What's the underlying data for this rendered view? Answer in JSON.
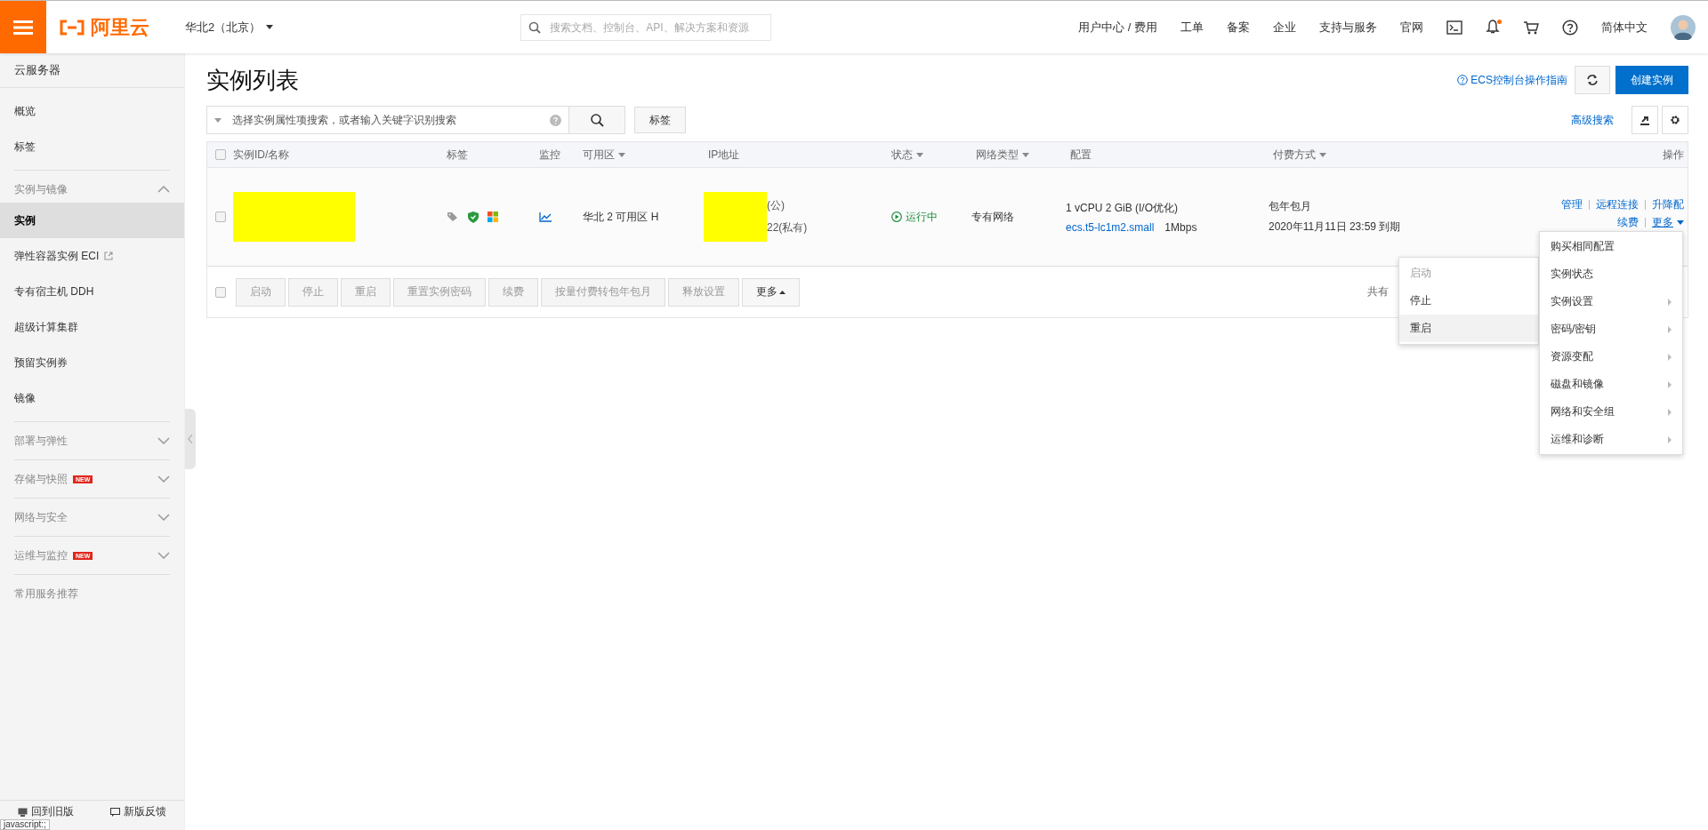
{
  "topbar": {
    "brand": "阿里云",
    "region": "华北2（北京）",
    "search_placeholder": "搜索文档、控制台、API、解决方案和资源",
    "links": [
      "用户中心 / 费用",
      "工单",
      "备案",
      "企业",
      "支持与服务",
      "官网"
    ],
    "unread_notifications": true,
    "language": "简体中文"
  },
  "sidebar": {
    "title": "云服务器",
    "groups": [
      {
        "items": [
          {
            "label": "概览",
            "selected": false,
            "external": false
          },
          {
            "label": "标签",
            "selected": false,
            "external": false
          }
        ]
      },
      {
        "heading": "实例与镜像",
        "expanded": true,
        "items": [
          {
            "label": "实例",
            "selected": true,
            "external": false
          },
          {
            "label": "弹性容器实例 ECI",
            "selected": false,
            "external": true
          },
          {
            "label": "专有宿主机 DDH",
            "selected": false,
            "external": false
          },
          {
            "label": "超级计算集群",
            "selected": false,
            "external": false
          },
          {
            "label": "预留实例券",
            "selected": false,
            "external": false
          },
          {
            "label": "镜像",
            "selected": false,
            "external": false
          }
        ]
      },
      {
        "heading": "部署与弹性",
        "expanded": false
      },
      {
        "heading": "存储与快照",
        "badge": "NEW",
        "expanded": false
      },
      {
        "heading": "网络与安全",
        "expanded": false
      },
      {
        "heading": "运维与监控",
        "badge": "NEW",
        "expanded": false
      },
      {
        "heading": "常用服务推荐"
      }
    ],
    "footer": [
      "回到旧版",
      "新版反馈"
    ]
  },
  "page": {
    "title": "实例列表",
    "guide_link": "ECS控制台操作指南",
    "create_button": "创建实例",
    "search_placeholder": "选择实例属性项搜索，或者输入关键字识别搜索",
    "tag_button": "标签",
    "advanced_search": "高级搜索"
  },
  "table": {
    "all_selected": false,
    "columns": [
      {
        "label": "实例ID/名称",
        "sortable": false
      },
      {
        "label": "标签",
        "sortable": false
      },
      {
        "label": "监控",
        "sortable": false
      },
      {
        "label": "可用区",
        "sortable": true
      },
      {
        "label": "IP地址",
        "sortable": false
      },
      {
        "label": "状态",
        "sortable": true
      },
      {
        "label": "网络类型",
        "sortable": true
      },
      {
        "label": "配置",
        "sortable": false
      },
      {
        "label": "付费方式",
        "sortable": true
      },
      {
        "label": "操作",
        "sortable": false
      }
    ],
    "rows": [
      {
        "selected": false,
        "zone": "华北 2 可用区 H",
        "ip_public": "(公)",
        "ip_private": "22(私有)",
        "status": "运行中",
        "network": "专有网络",
        "config": "1 vCPU 2 GiB (I/O优化)",
        "instance_type": "ecs.t5-lc1m2.small",
        "bandwidth": "1Mbps",
        "billing": "包年包月",
        "expiry": "2020年11月11日 23:59 到期",
        "actions": [
          "管理",
          "远程连接",
          "升降配",
          "续费",
          "更多"
        ]
      }
    ],
    "bulk_selected": false,
    "bulk_buttons": [
      {
        "label": "启动",
        "disabled": true
      },
      {
        "label": "停止",
        "disabled": true
      },
      {
        "label": "重启",
        "disabled": true
      },
      {
        "label": "重置实例密码",
        "disabled": true
      },
      {
        "label": "续费",
        "disabled": true
      },
      {
        "label": "按量付费转包年包月",
        "disabled": true
      },
      {
        "label": "释放设置",
        "disabled": true
      },
      {
        "label": "更多",
        "disabled": false
      }
    ],
    "total": "共有"
  },
  "batch_menu": [
    {
      "label": "启动",
      "disabled": true,
      "selected": false
    },
    {
      "label": "停止",
      "disabled": false,
      "selected": false
    },
    {
      "label": "重启",
      "disabled": false,
      "selected": true
    }
  ],
  "more_menu": [
    {
      "label": "购买相同配置",
      "submenu": false
    },
    {
      "label": "实例状态",
      "submenu": false
    },
    {
      "label": "实例设置",
      "submenu": true
    },
    {
      "label": "密码/密钥",
      "submenu": true
    },
    {
      "label": "资源变配",
      "submenu": true
    },
    {
      "label": "磁盘和镜像",
      "submenu": true
    },
    {
      "label": "网络和安全组",
      "submenu": true
    },
    {
      "label": "运维和诊断",
      "submenu": true
    }
  ],
  "status_tooltip": "javascript:;"
}
